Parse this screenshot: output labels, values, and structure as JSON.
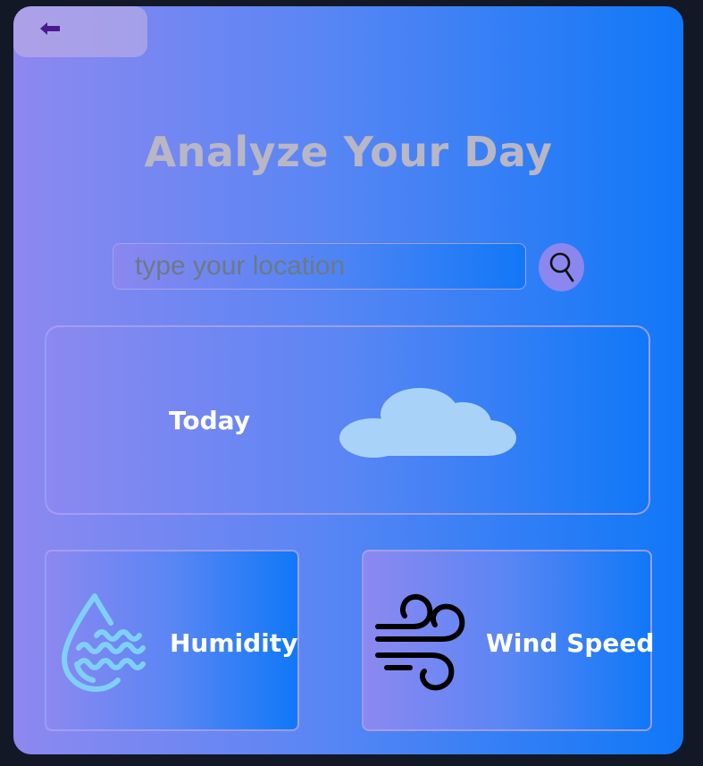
{
  "header": {
    "title": "Analyze Your Day"
  },
  "back_button": {
    "icon": "arrow-left-icon",
    "color": "#4a1a8c"
  },
  "search": {
    "placeholder": "type your location",
    "value": "",
    "button_icon": "search-icon"
  },
  "today": {
    "label": "Today",
    "icon": "cloud-icon"
  },
  "stats": {
    "humidity": {
      "label": "Humidity",
      "icon": "humidity-icon"
    },
    "wind": {
      "label": "Wind Speed",
      "icon": "wind-icon"
    }
  },
  "colors": {
    "page_background": "#121826",
    "gradient_start": "#8d88f0",
    "gradient_end": "#1078f7",
    "title": "#b9b6c5",
    "cloud": "#a8d2f7",
    "humidity_icon": "#7fd0f7"
  }
}
